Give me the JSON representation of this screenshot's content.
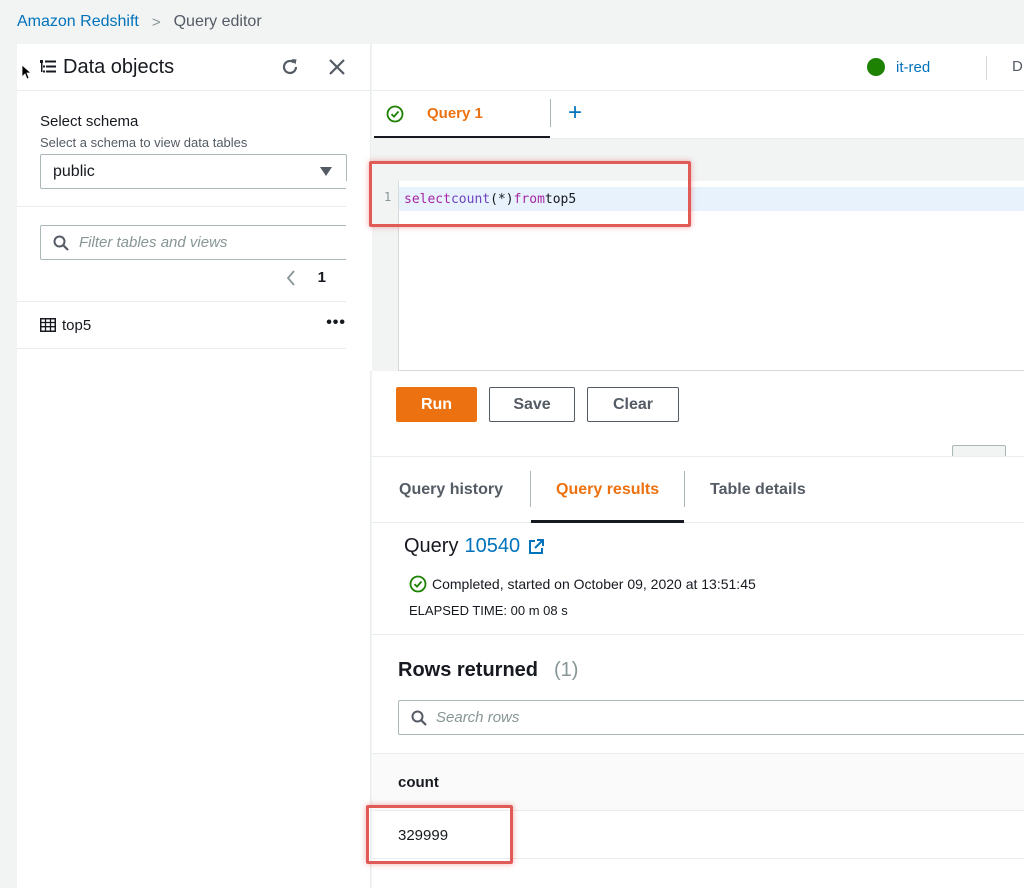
{
  "breadcrumb": {
    "service": "Amazon Redshift",
    "separator": ">",
    "current": "Query editor"
  },
  "sidebar": {
    "title": "Data objects",
    "schema_label": "Select schema",
    "schema_desc": "Select a schema to view data tables",
    "schema_value": "public",
    "filter_placeholder": "Filter tables and views",
    "page_number": "1",
    "tables": [
      {
        "name": "top5",
        "menu": "•••"
      }
    ]
  },
  "toolbar": {
    "cluster_name": "it-red",
    "cluster_status_color": "#1d8102",
    "database_truncated": "D"
  },
  "editor": {
    "tab_label": "Query 1",
    "add_tab": "+",
    "line_number": "1",
    "code_select": "select",
    "code_count": "count",
    "code_args": "(*)",
    "code_from": "from",
    "code_table": "top5",
    "run_label": "Run",
    "save_label": "Save",
    "clear_label": "Clear"
  },
  "results": {
    "tabs": [
      "Query history",
      "Query results",
      "Table details"
    ],
    "active_tab": "Query results",
    "query_label": "Query",
    "query_id": "10540",
    "status_text": "Completed, started on October 09, 2020 at 13:51:45",
    "elapsed": "ELAPSED TIME: 00 m 08 s",
    "rows_title": "Rows returned",
    "rows_count": "(1)",
    "search_placeholder": "Search rows",
    "columns": [
      "count"
    ],
    "rows": [
      [
        "329999"
      ]
    ]
  },
  "colors": {
    "accent": "#ec7211",
    "link": "#0073bb",
    "highlight": "#e05b55"
  }
}
